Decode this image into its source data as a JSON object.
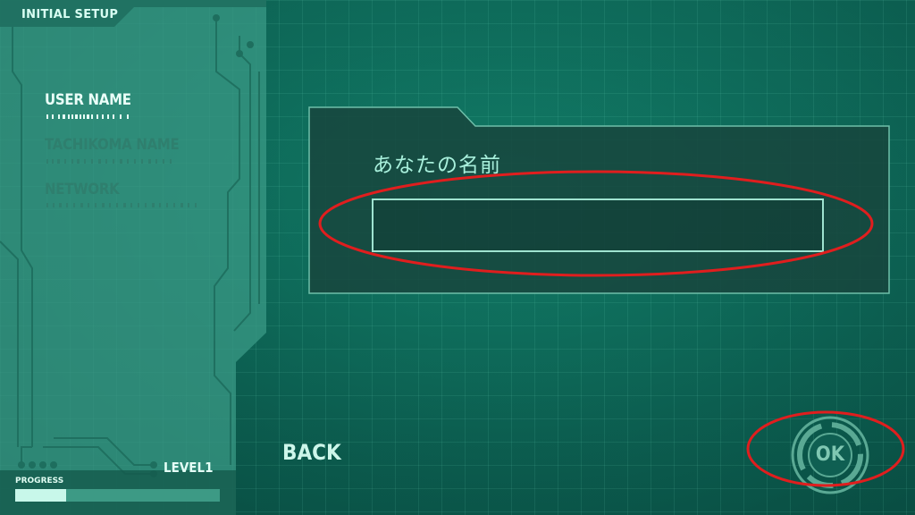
{
  "sidebar": {
    "title": "INITIAL SETUP",
    "items": [
      {
        "label": "USER NAME",
        "state": "active"
      },
      {
        "label": "TACHIKOMA NAME",
        "state": "inactive"
      },
      {
        "label": "NETWORK",
        "state": "inactive"
      }
    ],
    "level_label": "LEVEL1",
    "progress_label": "PROGRESS",
    "progress_value": 0.25
  },
  "form": {
    "prompt": "あなたの名前",
    "name_value": "",
    "name_placeholder": ""
  },
  "actions": {
    "back_label": "BACK",
    "ok_label": "OK"
  },
  "colors": {
    "background": "#0e6a5a",
    "panel": "#2f8f7c",
    "accent": "#c8f7ea",
    "annotation": "#e01e1e"
  }
}
